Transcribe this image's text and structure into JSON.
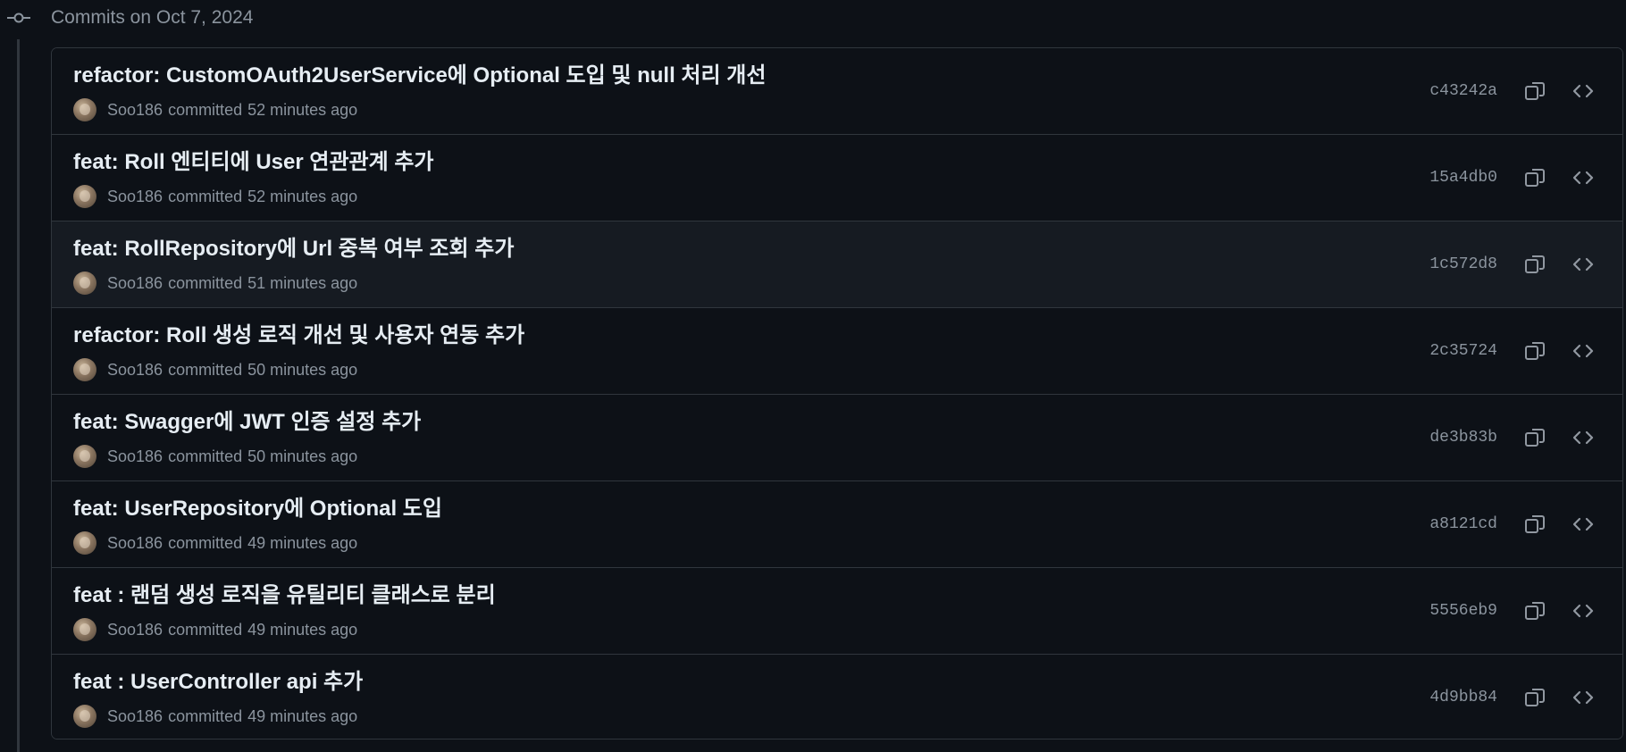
{
  "day_group": {
    "title": "Commits on Oct 7, 2024"
  },
  "commits": [
    {
      "title": "refactor: CustomOAuth2UserService에 Optional 도입 및 null 처리 개선",
      "author": "Soo186",
      "verb": "committed",
      "time": "52 minutes ago",
      "sha": "c43242a"
    },
    {
      "title": "feat: Roll 엔티티에 User 연관관계 추가",
      "author": "Soo186",
      "verb": "committed",
      "time": "52 minutes ago",
      "sha": "15a4db0"
    },
    {
      "title": "feat: RollRepository에 Url 중복 여부 조회 추가",
      "author": "Soo186",
      "verb": "committed",
      "time": "51 minutes ago",
      "sha": "1c572d8"
    },
    {
      "title": "refactor: Roll 생성 로직 개선 및 사용자 연동 추가",
      "author": "Soo186",
      "verb": "committed",
      "time": "50 minutes ago",
      "sha": "2c35724"
    },
    {
      "title": "feat: Swagger에 JWT 인증 설정 추가",
      "author": "Soo186",
      "verb": "committed",
      "time": "50 minutes ago",
      "sha": "de3b83b"
    },
    {
      "title": "feat: UserRepository에 Optional 도입",
      "author": "Soo186",
      "verb": "committed",
      "time": "49 minutes ago",
      "sha": "a8121cd"
    },
    {
      "title": "feat : 랜덤 생성 로직을 유틸리티 클래스로 분리",
      "author": "Soo186",
      "verb": "committed",
      "time": "49 minutes ago",
      "sha": "5556eb9"
    },
    {
      "title": "feat : UserController api 추가",
      "author": "Soo186",
      "verb": "committed",
      "time": "49 minutes ago",
      "sha": "4d9bb84"
    }
  ],
  "icons": {
    "timeline": "git-commit-icon",
    "copy": "copy-icon",
    "browse": "code-icon"
  },
  "colors": {
    "background": "#0d1117",
    "hover_row": "#161b22",
    "border": "#30363d",
    "text_primary": "#e6edf3",
    "text_muted": "#8b949e"
  }
}
